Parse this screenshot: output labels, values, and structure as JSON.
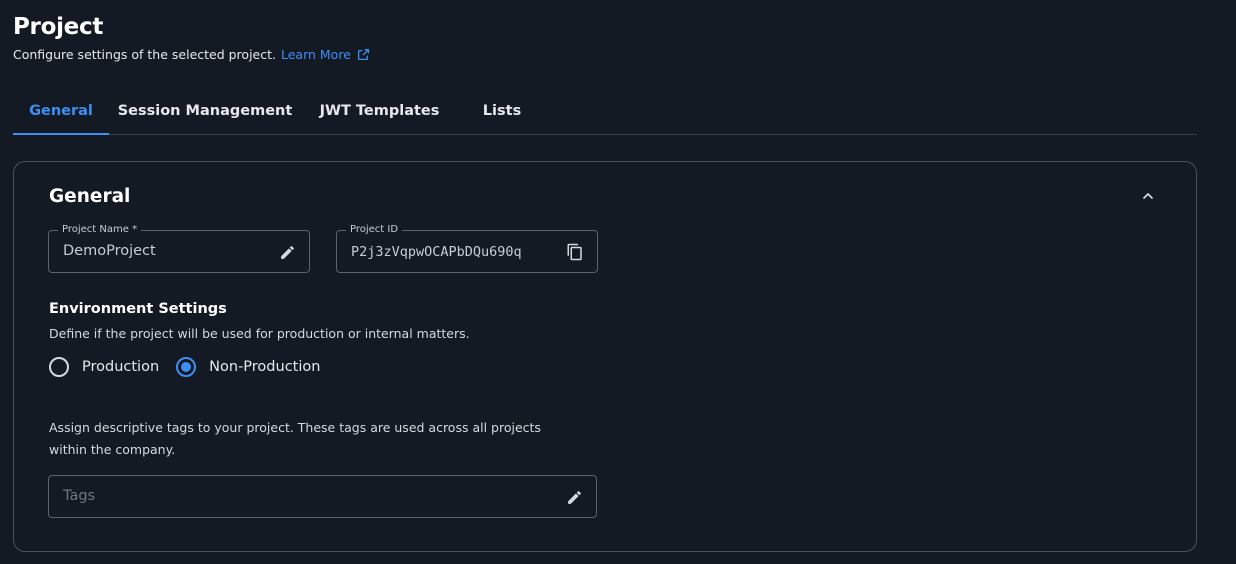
{
  "header": {
    "title": "Project",
    "subtitle": "Configure settings of the selected project.",
    "learn_more": "Learn More"
  },
  "tabs": [
    {
      "label": "General",
      "active": true
    },
    {
      "label": "Session Management",
      "active": false
    },
    {
      "label": "JWT Templates",
      "active": false
    },
    {
      "label": "Lists",
      "active": false
    }
  ],
  "general": {
    "title": "General",
    "project_name": {
      "label": "Project Name *",
      "value": "DemoProject"
    },
    "project_id": {
      "label": "Project ID",
      "value": "P2j3zVqpwOCAPbDQu690q"
    },
    "environment": {
      "title": "Environment Settings",
      "description": "Define if the project will be used for production or internal matters.",
      "options": [
        {
          "label": "Production",
          "selected": false
        },
        {
          "label": "Non-Production",
          "selected": true
        }
      ]
    },
    "tags": {
      "description": "Assign descriptive tags to your project. These tags are used across all projects within the company.",
      "placeholder": "Tags"
    }
  },
  "colors": {
    "background": "#141a24",
    "accent": "#3d8ff5",
    "border": "#4a515d"
  }
}
